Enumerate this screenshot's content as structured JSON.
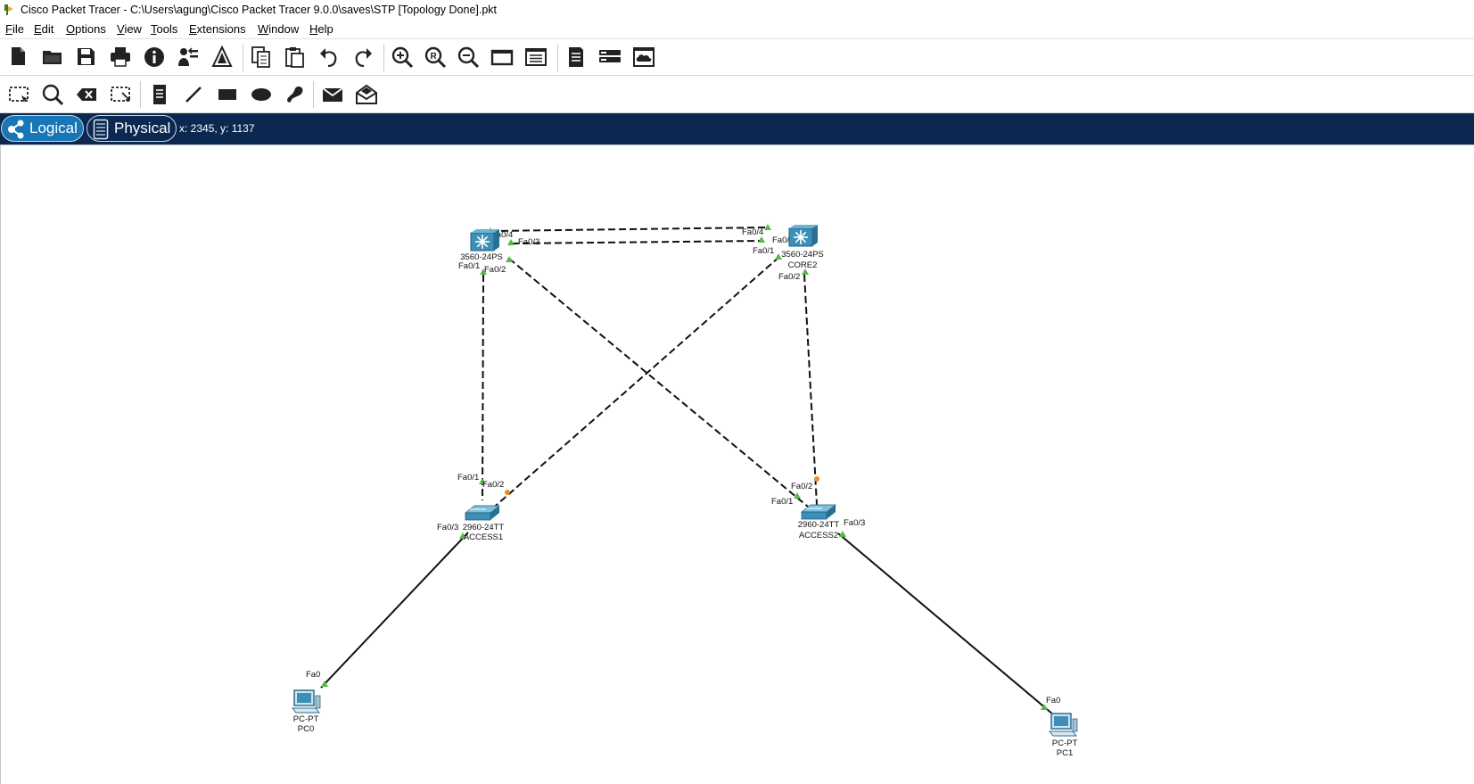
{
  "window": {
    "title": "Cisco Packet Tracer - C:\\Users\\agung\\Cisco Packet Tracer 9.0.0\\saves\\STP [Topology Done].pkt"
  },
  "menu": [
    "File",
    "Edit",
    "Options",
    "View",
    "Tools",
    "Extensions",
    "Window",
    "Help"
  ],
  "toolbar_main": [
    "new-file-icon",
    "open-folder-icon",
    "save-icon",
    "print-icon",
    "info-icon",
    "activity-wizard-icon",
    "custom-devices-icon",
    "copy-icon",
    "paste-icon",
    "undo-icon",
    "redo-icon",
    "zoom-in-icon",
    "zoom-reset-icon",
    "zoom-out-icon",
    "drawing-palette-icon",
    "custom-device-dialog-icon",
    "viewport-icon",
    "cluster-icon",
    "cloud-icon"
  ],
  "toolbar_tools": [
    "select-icon",
    "inspect-icon",
    "delete-icon",
    "resize-icon",
    "note-icon",
    "draw-line-icon",
    "draw-rectangle-icon",
    "draw-ellipse-icon",
    "freeform-icon",
    "simple-pdu-icon",
    "complex-pdu-icon"
  ],
  "modes": {
    "logical": "Logical",
    "physical": "Physical",
    "active": "Logical",
    "coordinates": "x: 2345, y: 1137"
  },
  "topology": {
    "devices": [
      {
        "id": "core1",
        "model": "3560-24PS",
        "name": "",
        "type": "multilayer-switch"
      },
      {
        "id": "core2",
        "model": "3560-24PS",
        "name": "CORE2",
        "type": "multilayer-switch"
      },
      {
        "id": "access1",
        "model": "2960-24TT",
        "name": "ACCESS1",
        "type": "switch"
      },
      {
        "id": "access2",
        "model": "2960-24TT",
        "name": "ACCESS2",
        "type": "switch"
      },
      {
        "id": "pc0",
        "model": "PC-PT",
        "name": "PC0",
        "type": "pc"
      },
      {
        "id": "pc1",
        "model": "PC-PT",
        "name": "PC1",
        "type": "pc"
      }
    ],
    "links": [
      {
        "a": "core1",
        "a_port": "Fa0/4",
        "b": "core2",
        "b_port": "Fa0/4",
        "cable": "crossover",
        "a_led": "green",
        "b_led": "green"
      },
      {
        "a": "core1",
        "a_port": "Fa0/3",
        "b": "core2",
        "b_port": "Fa0/3",
        "cable": "crossover",
        "a_led": "green",
        "b_led": "green"
      },
      {
        "a": "core1",
        "a_port": "Fa0/1",
        "b": "access1",
        "b_port": "Fa0/1",
        "cable": "crossover",
        "a_led": "green",
        "b_led": "green"
      },
      {
        "a": "core1",
        "a_port": "Fa0/2",
        "b": "access2",
        "b_port": "Fa0/1",
        "cable": "crossover",
        "a_led": "green",
        "b_led": "green"
      },
      {
        "a": "core2",
        "a_port": "Fa0/1",
        "b": "access1",
        "b_port": "Fa0/2",
        "cable": "crossover",
        "a_led": "green",
        "b_led": "orange"
      },
      {
        "a": "core2",
        "a_port": "Fa0/2",
        "b": "access2",
        "b_port": "Fa0/2",
        "cable": "crossover",
        "a_led": "green",
        "b_led": "orange"
      },
      {
        "a": "access1",
        "a_port": "Fa0/3",
        "b": "pc0",
        "b_port": "Fa0",
        "cable": "straight",
        "a_led": "green",
        "b_led": "green"
      },
      {
        "a": "access2",
        "a_port": "Fa0/3",
        "b": "pc1",
        "b_port": "Fa0",
        "cable": "straight",
        "a_led": "green",
        "b_led": "green"
      }
    ]
  },
  "colors": {
    "mode_bar": "#0b2850",
    "logical_tab": "#1876b7",
    "link_up": "#57b947",
    "link_blocking": "#f08a1c",
    "device_body": "#3d8fb8"
  }
}
